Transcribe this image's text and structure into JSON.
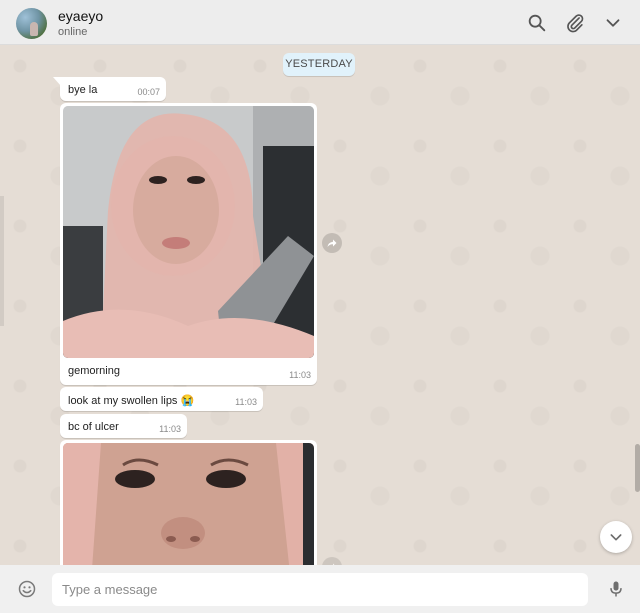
{
  "header": {
    "contact_name": "eyaeyo",
    "contact_status": "online",
    "icons": [
      "search-icon",
      "attach-icon",
      "chevron-down-icon"
    ]
  },
  "chat": {
    "date_divider": "YESTERDAY",
    "messages": [
      {
        "type": "text",
        "text": "bye la",
        "time": "00:07"
      },
      {
        "type": "image",
        "caption": "gemorning",
        "time": "11:03"
      },
      {
        "type": "text",
        "text": "look at my swollen lips 😭",
        "time": "11:03"
      },
      {
        "type": "text",
        "text": "bc of ulcer",
        "time": "11:03"
      },
      {
        "type": "image",
        "caption": "",
        "time": ""
      }
    ]
  },
  "composer": {
    "placeholder": "Type a message"
  },
  "colors": {
    "chat_background": "#e5ddd5",
    "date_pill": "#e1f2fb",
    "header": "#ededed"
  }
}
